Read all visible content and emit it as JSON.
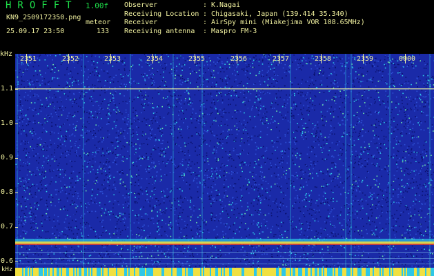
{
  "header": {
    "app_title": "HROFFT",
    "version": "1.00f",
    "filename": "KN9_2509172350.png",
    "mode": "meteor",
    "datetime": "25.09.17 23:50",
    "count": "133",
    "info": [
      {
        "key": "Observer",
        "value": "K.Nagai"
      },
      {
        "key": "Receiving Location",
        "value": "Chigasaki, Japan (139.414 35.340)"
      },
      {
        "key": "Receiver",
        "value": "AirSpy mini (Miakejima VOR 108.65MHz)"
      },
      {
        "key": "Receiving antenna",
        "value": "Maspro FM-3"
      }
    ]
  },
  "axes": {
    "unit_top": "kHz",
    "unit_bottom": "kHz",
    "freq_labels": [
      "1.1",
      "1.0",
      "0.9",
      "0.8",
      "0.7",
      "0.6"
    ],
    "time_labels": [
      "2351",
      "2352",
      "2353",
      "2354",
      "2355",
      "2356",
      "2357",
      "2358",
      "2359",
      "0000"
    ]
  },
  "colors": {
    "background": "#1a2aa8",
    "label": "#f2f2a0",
    "title": "#1ee04a"
  }
}
